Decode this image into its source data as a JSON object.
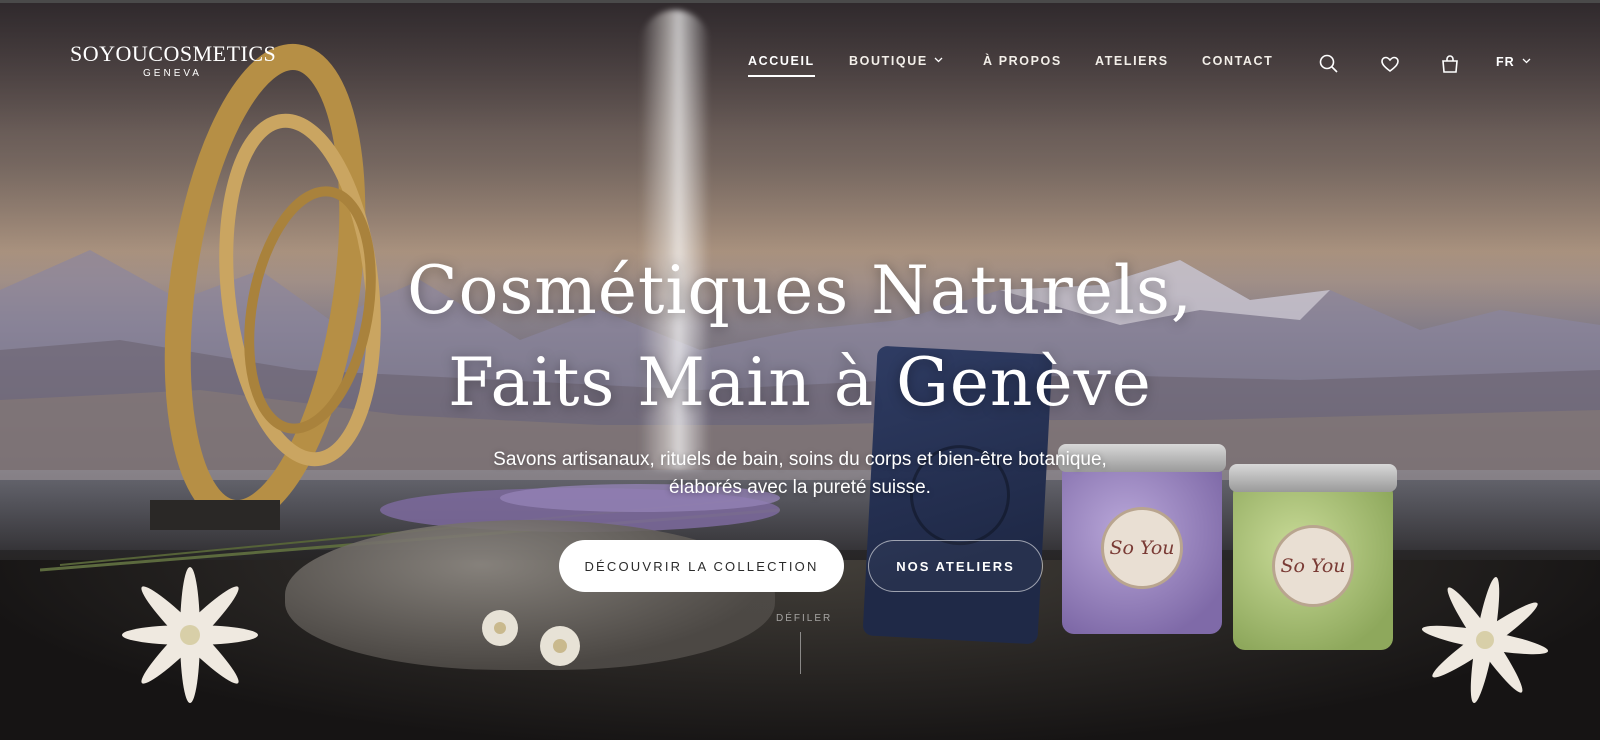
{
  "brand": {
    "name": "SOYOUCOSMETICS",
    "location": "GENEVA"
  },
  "nav": {
    "items": [
      {
        "label": "ACCUEIL",
        "active": true
      },
      {
        "label": "BOUTIQUE",
        "has_dropdown": true
      },
      {
        "label": "À PROPOS"
      },
      {
        "label": "ATELIERS"
      },
      {
        "label": "CONTACT"
      }
    ],
    "icons": [
      "search-icon",
      "heart-icon",
      "shopping-bag-icon"
    ],
    "language": "FR"
  },
  "hero": {
    "title_line1": "Cosmétiques Naturels,",
    "title_line2": "Faits Main à Genève",
    "subtitle_line1": "Savons artisanaux, rituels de bain, soins du corps et bien-être botanique,",
    "subtitle_line2": "élaborés avec la pureté suisse.",
    "primary_cta": "DÉCOUVRIR LA COLLECTION",
    "secondary_cta": "NOS ATELIERS",
    "scroll_hint": "DÉFILER",
    "jar_label": "So You"
  },
  "colors": {
    "text": "#ffffff",
    "gold": "#b8914a",
    "soap": "#2b3759",
    "lavender": "#9b87c4",
    "green": "#a8bf72"
  }
}
